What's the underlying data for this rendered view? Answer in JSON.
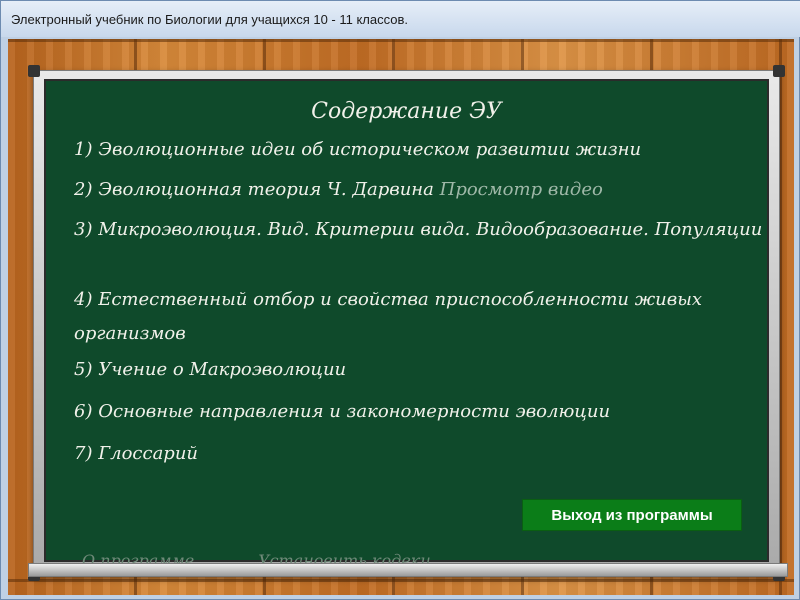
{
  "window": {
    "title": "Электронный учебник по Биологии для учащихся 10 - 11 классов."
  },
  "board": {
    "title": "Содержание ЭУ",
    "items": [
      {
        "text": "1) Эволюционные идеи об историческом развитии жизни"
      },
      {
        "text": "2) Эволюционная теория Ч. Дарвина",
        "link": "Просмотр видео"
      },
      {
        "text": "3) Микроэволюция. Вид. Критерии вида. Видообразование. Популяции"
      },
      {
        "text": "4) Естественный отбор и свойства приспособленности живых организмов"
      },
      {
        "text": "5) Учение о Макроэволюции"
      },
      {
        "text": "6) Основные направления и закономерности эволюции"
      },
      {
        "text": "7) Глоссарий"
      }
    ],
    "footer": {
      "about": "О программе",
      "codecs": "Установить кодеки",
      "exit": "Выход из программы"
    }
  }
}
